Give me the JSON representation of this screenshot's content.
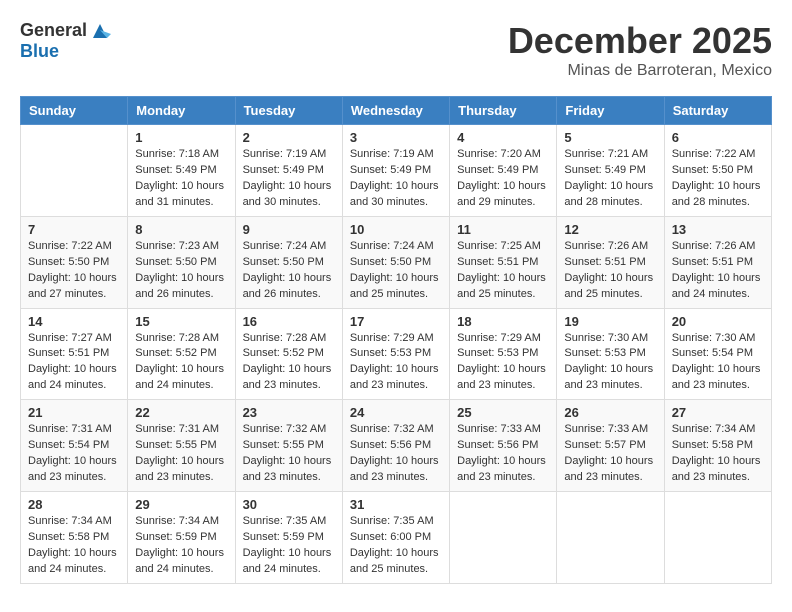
{
  "header": {
    "logo_general": "General",
    "logo_blue": "Blue",
    "month": "December 2025",
    "location": "Minas de Barroteran, Mexico"
  },
  "columns": [
    "Sunday",
    "Monday",
    "Tuesday",
    "Wednesday",
    "Thursday",
    "Friday",
    "Saturday"
  ],
  "weeks": [
    [
      {
        "day": "",
        "info": ""
      },
      {
        "day": "1",
        "info": "Sunrise: 7:18 AM\nSunset: 5:49 PM\nDaylight: 10 hours\nand 31 minutes."
      },
      {
        "day": "2",
        "info": "Sunrise: 7:19 AM\nSunset: 5:49 PM\nDaylight: 10 hours\nand 30 minutes."
      },
      {
        "day": "3",
        "info": "Sunrise: 7:19 AM\nSunset: 5:49 PM\nDaylight: 10 hours\nand 30 minutes."
      },
      {
        "day": "4",
        "info": "Sunrise: 7:20 AM\nSunset: 5:49 PM\nDaylight: 10 hours\nand 29 minutes."
      },
      {
        "day": "5",
        "info": "Sunrise: 7:21 AM\nSunset: 5:49 PM\nDaylight: 10 hours\nand 28 minutes."
      },
      {
        "day": "6",
        "info": "Sunrise: 7:22 AM\nSunset: 5:50 PM\nDaylight: 10 hours\nand 28 minutes."
      }
    ],
    [
      {
        "day": "7",
        "info": "Sunrise: 7:22 AM\nSunset: 5:50 PM\nDaylight: 10 hours\nand 27 minutes."
      },
      {
        "day": "8",
        "info": "Sunrise: 7:23 AM\nSunset: 5:50 PM\nDaylight: 10 hours\nand 26 minutes."
      },
      {
        "day": "9",
        "info": "Sunrise: 7:24 AM\nSunset: 5:50 PM\nDaylight: 10 hours\nand 26 minutes."
      },
      {
        "day": "10",
        "info": "Sunrise: 7:24 AM\nSunset: 5:50 PM\nDaylight: 10 hours\nand 25 minutes."
      },
      {
        "day": "11",
        "info": "Sunrise: 7:25 AM\nSunset: 5:51 PM\nDaylight: 10 hours\nand 25 minutes."
      },
      {
        "day": "12",
        "info": "Sunrise: 7:26 AM\nSunset: 5:51 PM\nDaylight: 10 hours\nand 25 minutes."
      },
      {
        "day": "13",
        "info": "Sunrise: 7:26 AM\nSunset: 5:51 PM\nDaylight: 10 hours\nand 24 minutes."
      }
    ],
    [
      {
        "day": "14",
        "info": "Sunrise: 7:27 AM\nSunset: 5:51 PM\nDaylight: 10 hours\nand 24 minutes."
      },
      {
        "day": "15",
        "info": "Sunrise: 7:28 AM\nSunset: 5:52 PM\nDaylight: 10 hours\nand 24 minutes."
      },
      {
        "day": "16",
        "info": "Sunrise: 7:28 AM\nSunset: 5:52 PM\nDaylight: 10 hours\nand 23 minutes."
      },
      {
        "day": "17",
        "info": "Sunrise: 7:29 AM\nSunset: 5:53 PM\nDaylight: 10 hours\nand 23 minutes."
      },
      {
        "day": "18",
        "info": "Sunrise: 7:29 AM\nSunset: 5:53 PM\nDaylight: 10 hours\nand 23 minutes."
      },
      {
        "day": "19",
        "info": "Sunrise: 7:30 AM\nSunset: 5:53 PM\nDaylight: 10 hours\nand 23 minutes."
      },
      {
        "day": "20",
        "info": "Sunrise: 7:30 AM\nSunset: 5:54 PM\nDaylight: 10 hours\nand 23 minutes."
      }
    ],
    [
      {
        "day": "21",
        "info": "Sunrise: 7:31 AM\nSunset: 5:54 PM\nDaylight: 10 hours\nand 23 minutes."
      },
      {
        "day": "22",
        "info": "Sunrise: 7:31 AM\nSunset: 5:55 PM\nDaylight: 10 hours\nand 23 minutes."
      },
      {
        "day": "23",
        "info": "Sunrise: 7:32 AM\nSunset: 5:55 PM\nDaylight: 10 hours\nand 23 minutes."
      },
      {
        "day": "24",
        "info": "Sunrise: 7:32 AM\nSunset: 5:56 PM\nDaylight: 10 hours\nand 23 minutes."
      },
      {
        "day": "25",
        "info": "Sunrise: 7:33 AM\nSunset: 5:56 PM\nDaylight: 10 hours\nand 23 minutes."
      },
      {
        "day": "26",
        "info": "Sunrise: 7:33 AM\nSunset: 5:57 PM\nDaylight: 10 hours\nand 23 minutes."
      },
      {
        "day": "27",
        "info": "Sunrise: 7:34 AM\nSunset: 5:58 PM\nDaylight: 10 hours\nand 23 minutes."
      }
    ],
    [
      {
        "day": "28",
        "info": "Sunrise: 7:34 AM\nSunset: 5:58 PM\nDaylight: 10 hours\nand 24 minutes."
      },
      {
        "day": "29",
        "info": "Sunrise: 7:34 AM\nSunset: 5:59 PM\nDaylight: 10 hours\nand 24 minutes."
      },
      {
        "day": "30",
        "info": "Sunrise: 7:35 AM\nSunset: 5:59 PM\nDaylight: 10 hours\nand 24 minutes."
      },
      {
        "day": "31",
        "info": "Sunrise: 7:35 AM\nSunset: 6:00 PM\nDaylight: 10 hours\nand 25 minutes."
      },
      {
        "day": "",
        "info": ""
      },
      {
        "day": "",
        "info": ""
      },
      {
        "day": "",
        "info": ""
      }
    ]
  ]
}
